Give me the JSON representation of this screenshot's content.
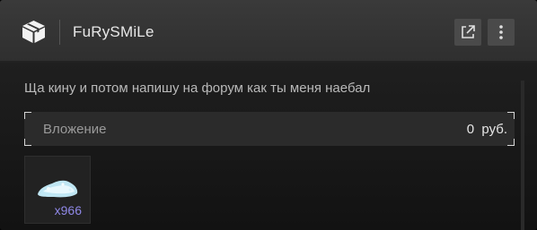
{
  "header": {
    "logo_icon": "box-icon",
    "title": "FuRySMiLe",
    "open_external_icon": "external-link-icon",
    "more_icon": "more-vertical-icon"
  },
  "message": {
    "text": "Ща кину и потом напишу на форум как ты меня наебал"
  },
  "attachment": {
    "label": "Вложение",
    "price": "0  руб."
  },
  "item": {
    "icon": "item-pile-icon",
    "count": "x966",
    "count_color": "#8f88e6"
  }
}
